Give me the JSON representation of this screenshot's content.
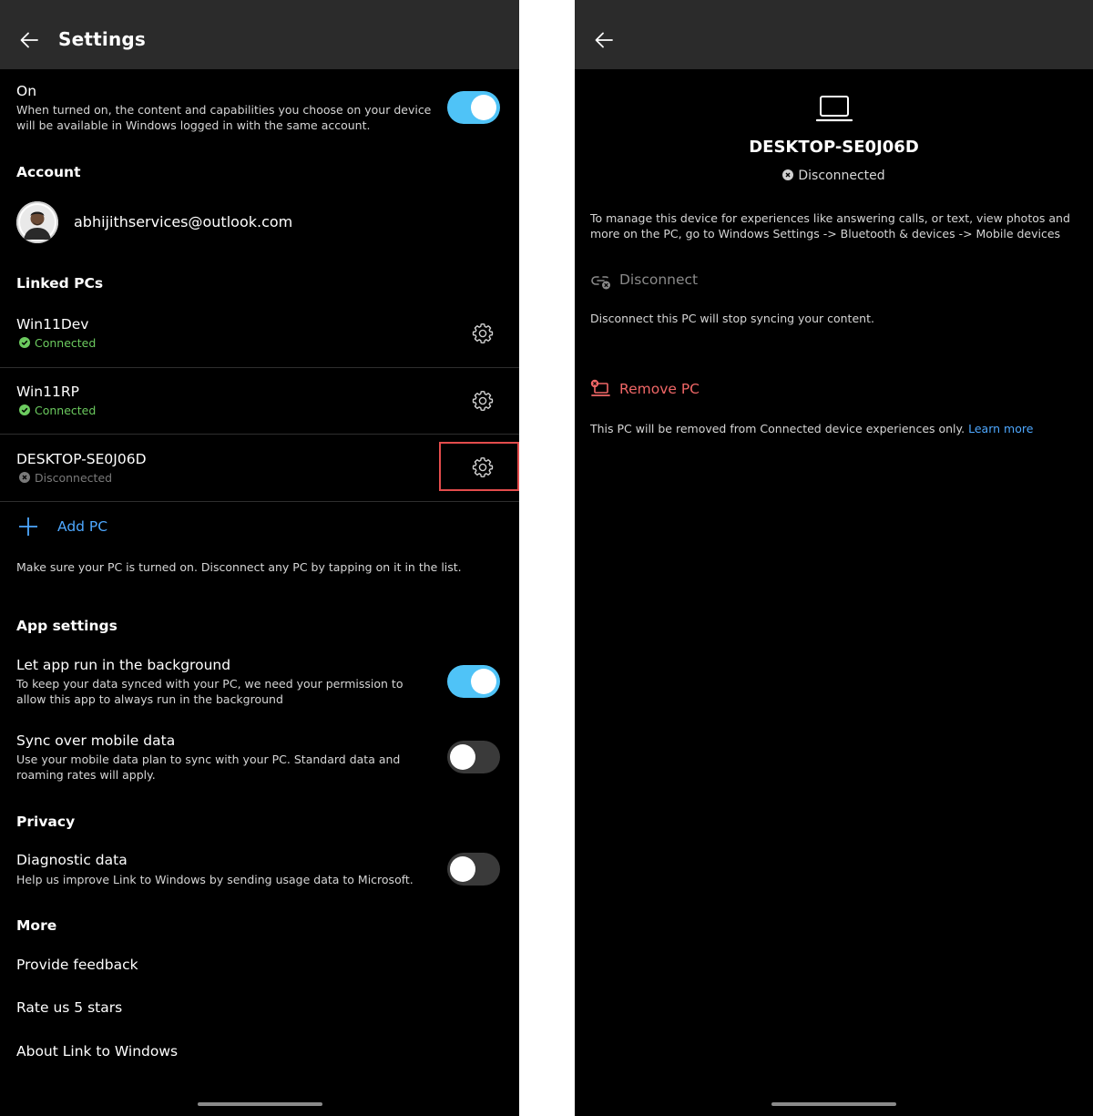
{
  "left": {
    "header": {
      "title": "Settings"
    },
    "on_setting": {
      "title": "On",
      "description": "When turned on, the content and capabilities you choose on your device will be available in Windows logged in with the same account.",
      "enabled": true
    },
    "account": {
      "heading": "Account",
      "email": "abhijithservices@outlook.com"
    },
    "linked_pcs": {
      "heading": "Linked PCs",
      "items": [
        {
          "name": "Win11Dev",
          "status": "Connected",
          "status_color": "#6ccb5f"
        },
        {
          "name": "Win11RP",
          "status": "Connected",
          "status_color": "#6ccb5f"
        },
        {
          "name": "DESKTOP-SE0J06D",
          "status": "Disconnected",
          "status_color": "#7a7a7a"
        }
      ],
      "add_label": "Add PC",
      "hint": "Make sure your PC is turned on. Disconnect any PC by tapping on it in the list."
    },
    "app_settings": {
      "heading": "App settings",
      "background": {
        "title": "Let app run in the background",
        "description": "To keep your data synced with your PC, we need your permission to allow this app to always run in the background",
        "enabled": true
      },
      "mobile_data": {
        "title": "Sync over mobile data",
        "description": "Use your mobile data plan to sync with your PC. Standard data and roaming rates will apply.",
        "enabled": false
      }
    },
    "privacy": {
      "heading": "Privacy",
      "diagnostic": {
        "title": "Diagnostic data",
        "description": "Help us improve Link to Windows by sending usage data to Microsoft.",
        "enabled": false
      }
    },
    "more": {
      "heading": "More",
      "items": [
        "Provide feedback",
        "Rate us 5 stars",
        "About Link to Windows"
      ]
    }
  },
  "right": {
    "device_name": "DESKTOP-SE0J06D",
    "status": "Disconnected",
    "manage_text": "To manage this device for experiences like answering calls, or text, view photos and more on the PC, go to Windows Settings -> Bluetooth & devices -> Mobile devices",
    "disconnect_label": "Disconnect",
    "disconnect_desc": "Disconnect this PC will stop syncing your content.",
    "remove_label": "Remove PC",
    "remove_desc": "This PC will be removed from Connected device experiences only.",
    "learn_more": "Learn more"
  },
  "colors": {
    "accent_blue": "#4fc3f7",
    "link_blue": "#4ea8ff",
    "remove_red": "#f06767",
    "connected_green": "#6ccb5f",
    "highlight_red": "#e34c4c"
  }
}
